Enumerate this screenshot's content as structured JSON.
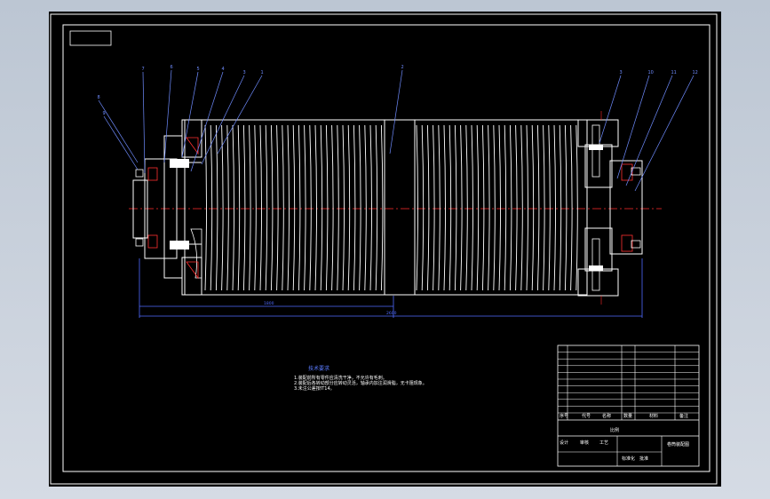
{
  "drawing": {
    "colors": {
      "background": "#000000",
      "outline": "#ffffff",
      "centerline": "#ff2a2a",
      "leader": "#6f8cff",
      "hatch": "#ff3030",
      "dimension": "#4f6bff"
    },
    "leader_labels_left": [
      "8",
      "9",
      "7",
      "6",
      "5",
      "4",
      "3",
      "1"
    ],
    "leader_labels_center": [
      "2"
    ],
    "leader_labels_right": [
      "3",
      "10",
      "11",
      "12"
    ],
    "dimension_left": "1800",
    "dimension_total": "2600"
  },
  "notes": {
    "title": "技术要求",
    "lines": [
      "1.装配前所有零件应清洗干净，不允许有毛刺。",
      "2.装配后各转动部分应转动灵活，轴承内加注润滑脂，无卡阻现象。",
      "3.未注公差按IT14。"
    ]
  },
  "title_block": {
    "part_name": "卷筒装配图",
    "scale_label": "比例",
    "row_labels": [
      "序号",
      "代号",
      "名称",
      "数量",
      "材料",
      "备注"
    ],
    "bottom_labels": [
      "设计",
      "审核",
      "工艺",
      "标准化",
      "批准"
    ]
  }
}
